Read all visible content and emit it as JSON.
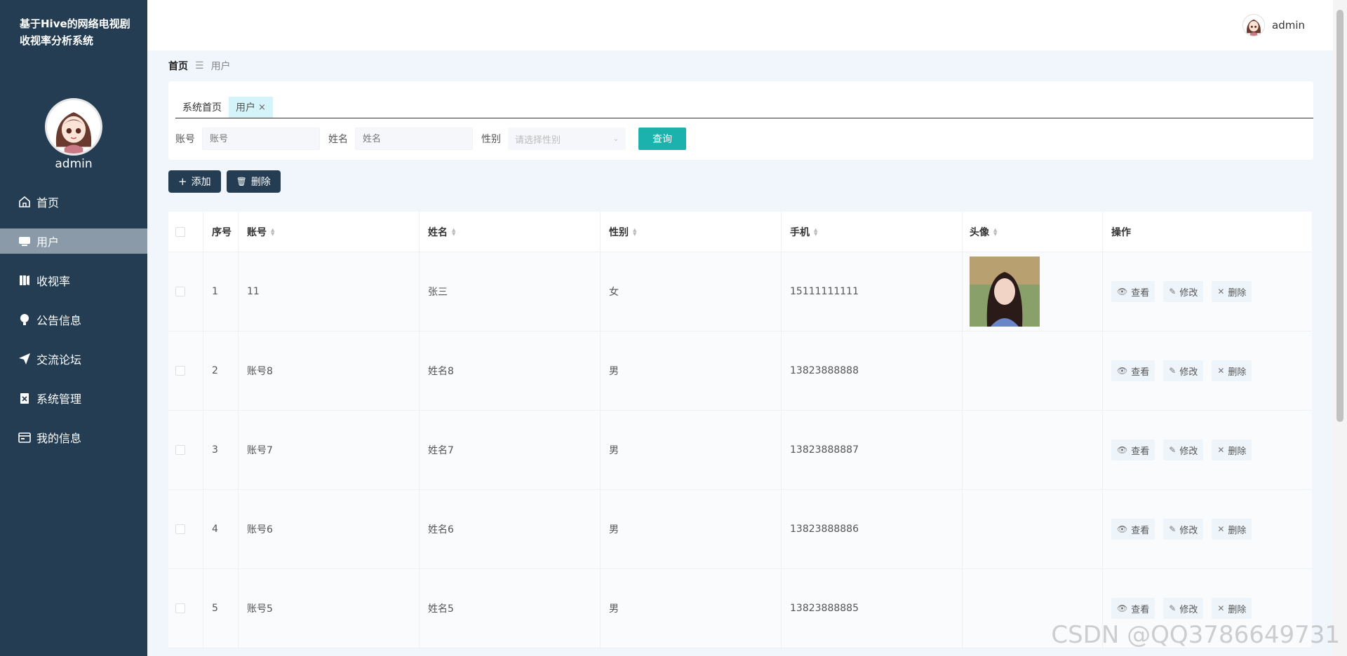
{
  "sidebar": {
    "title": "基于Hive的网络电视剧收视率分析系统",
    "username": "admin",
    "items": [
      {
        "label": "首页",
        "icon": "home-icon"
      },
      {
        "label": "用户",
        "icon": "monitor-icon"
      },
      {
        "label": "收视率",
        "icon": "book-icon"
      },
      {
        "label": "公告信息",
        "icon": "bulb-icon"
      },
      {
        "label": "交流论坛",
        "icon": "paper-plane-icon"
      },
      {
        "label": "系统管理",
        "icon": "clipboard-icon"
      },
      {
        "label": "我的信息",
        "icon": "card-icon"
      }
    ]
  },
  "header": {
    "username": "admin"
  },
  "breadcrumb": {
    "home": "首页",
    "separator": "☰",
    "current": "用户"
  },
  "tabs": [
    {
      "label": "系统首页"
    },
    {
      "label": "用户",
      "close": "×"
    }
  ],
  "filters": {
    "account_label": "账号",
    "account_placeholder": "账号",
    "name_label": "姓名",
    "name_placeholder": "姓名",
    "gender_label": "性别",
    "gender_placeholder": "请选择性别",
    "query_label": "查询"
  },
  "toolbar": {
    "add_label": "添加",
    "delete_label": "删除"
  },
  "table": {
    "headers": [
      "序号",
      "账号",
      "姓名",
      "性别",
      "手机",
      "头像",
      "操作"
    ],
    "rows": [
      {
        "index": "1",
        "account": "11",
        "name": "张三",
        "gender": "女",
        "phone": "15111111111"
      },
      {
        "index": "2",
        "account": "账号8",
        "name": "姓名8",
        "gender": "男",
        "phone": "13823888888"
      },
      {
        "index": "3",
        "account": "账号7",
        "name": "姓名7",
        "gender": "男",
        "phone": "13823888887"
      },
      {
        "index": "4",
        "account": "账号6",
        "name": "姓名6",
        "gender": "男",
        "phone": "13823888886"
      },
      {
        "index": "5",
        "account": "账号5",
        "name": "姓名5",
        "gender": "男",
        "phone": "13823888885"
      }
    ],
    "ops": {
      "view": "查看",
      "edit": "修改",
      "delete": "删除"
    }
  },
  "watermark": "CSDN @QQ3786649731",
  "colors": {
    "sidebar": "#243d52",
    "accent": "#1bb1ad",
    "active_menu": "#8a9aa8"
  }
}
